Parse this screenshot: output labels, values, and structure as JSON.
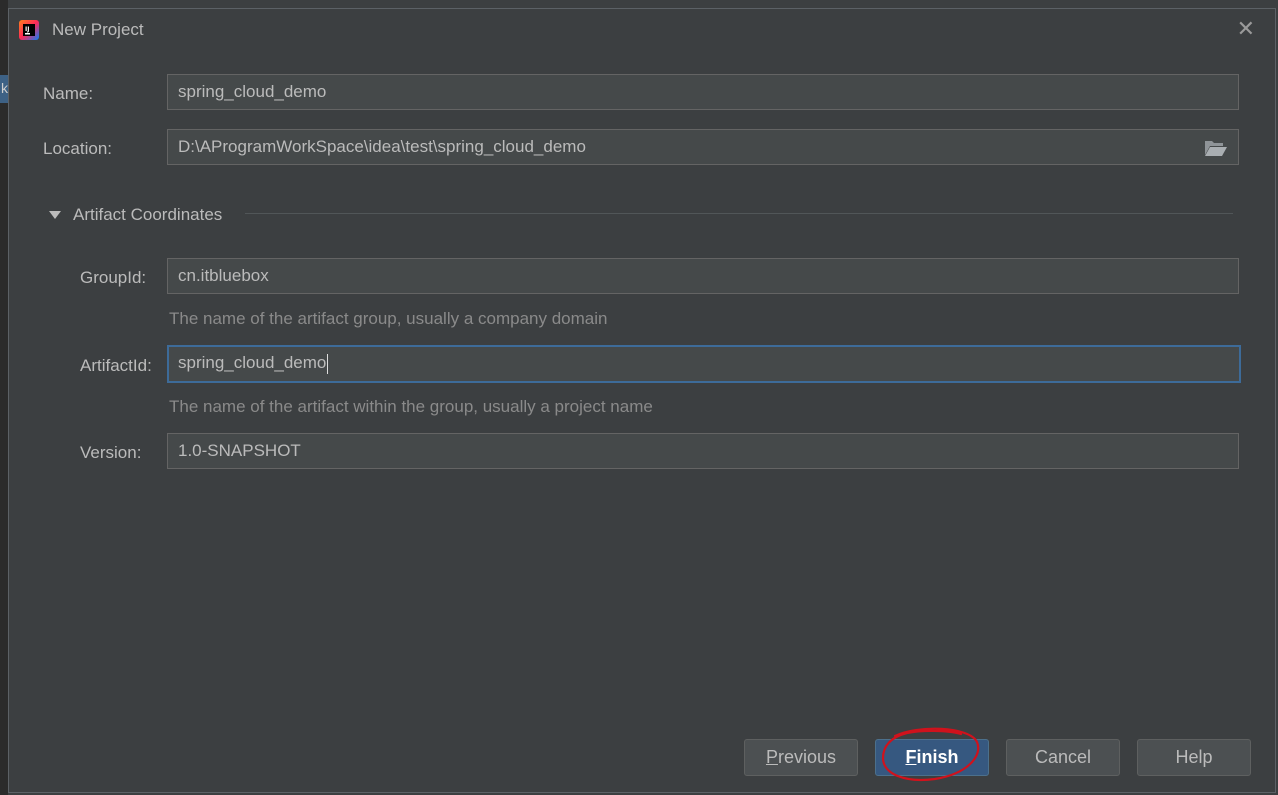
{
  "window": {
    "title": "New Project"
  },
  "form": {
    "name_label": "Name:",
    "name_value": "spring_cloud_demo",
    "location_label": "Location:",
    "location_value": "D:\\AProgramWorkSpace\\idea\\test\\spring_cloud_demo"
  },
  "artifact": {
    "section_label": "Artifact Coordinates",
    "group_label": "GroupId:",
    "group_value": "cn.itbluebox",
    "group_hint": "The name of the artifact group, usually a company domain",
    "artifact_label": "ArtifactId:",
    "artifact_value": "spring_cloud_demo",
    "artifact_hint": "The name of the artifact within the group, usually a project name",
    "version_label": "Version:",
    "version_value": "1.0-SNAPSHOT"
  },
  "buttons": {
    "previous_mnemonic": "P",
    "previous_rest": "revious",
    "finish_mnemonic": "F",
    "finish_rest": "inish",
    "cancel": "Cancel",
    "help": "Help"
  },
  "icons": {
    "app": "intellij-idea-icon",
    "close": "close-icon",
    "browse": "folder-open-icon",
    "expand": "triangle-down-icon"
  },
  "colors": {
    "background": "#3c3f41",
    "field_bg": "#45494a",
    "focus_border": "#3d6b99",
    "primary_button": "#365880",
    "annotation": "#d0121c"
  }
}
